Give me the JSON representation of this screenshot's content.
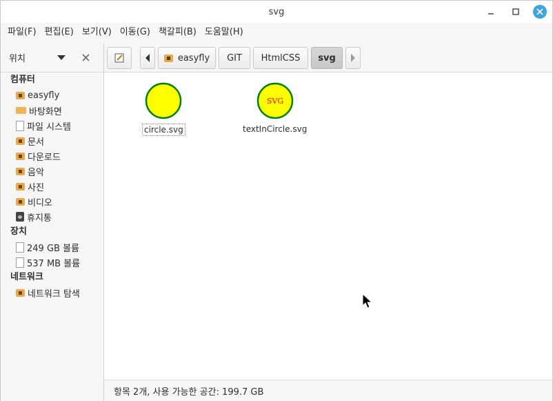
{
  "window": {
    "title": "svg"
  },
  "menubar": [
    "파일(F)",
    "편집(E)",
    "보기(V)",
    "이동(G)",
    "책갈피(B)",
    "도움말(H)"
  ],
  "sidebar_header": {
    "label": "위치"
  },
  "toolbar": {
    "breadcrumbs": [
      "easyfly",
      "GIT",
      "HtmlCSS",
      "svg"
    ],
    "active_crumb": "svg"
  },
  "sidebar": {
    "sections": [
      {
        "title": "컴퓨터",
        "items": [
          {
            "label": "easyfly",
            "icon": "home-folder-icon"
          },
          {
            "label": "바탕화면",
            "icon": "desktop-icon"
          },
          {
            "label": "파일 시스템",
            "icon": "drive-icon"
          },
          {
            "label": "문서",
            "icon": "documents-folder-icon"
          },
          {
            "label": "다운로드",
            "icon": "downloads-folder-icon"
          },
          {
            "label": "음악",
            "icon": "music-folder-icon"
          },
          {
            "label": "사진",
            "icon": "pictures-folder-icon"
          },
          {
            "label": "비디오",
            "icon": "videos-folder-icon"
          },
          {
            "label": "휴지통",
            "icon": "trash-icon"
          }
        ]
      },
      {
        "title": "장치",
        "items": [
          {
            "label": "249 GB 볼륨",
            "icon": "drive-icon"
          },
          {
            "label": "537 MB 볼륨",
            "icon": "drive-icon"
          }
        ]
      },
      {
        "title": "네트워크",
        "items": [
          {
            "label": "네트워크 탐색",
            "icon": "network-folder-icon"
          }
        ]
      }
    ]
  },
  "files": [
    {
      "name": "circle.svg",
      "thumb_text": "",
      "selected": true
    },
    {
      "name": "textInCircle.svg",
      "thumb_text": "SVG",
      "selected": false
    }
  ],
  "thumbnail_colors": {
    "fill": "#ffff00",
    "stroke": "#008000",
    "text": "#ff0000"
  },
  "status": {
    "text": "항목 2개, 사용 가능한 공간: 199.7 GB"
  }
}
